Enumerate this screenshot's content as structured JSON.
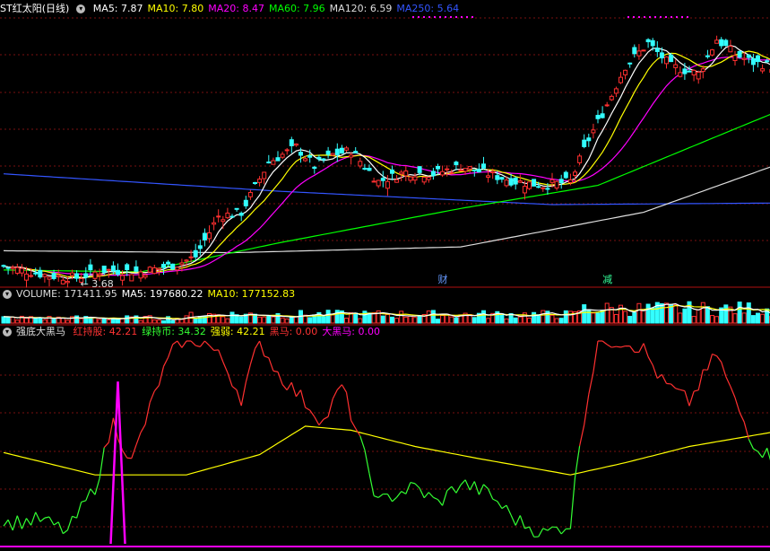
{
  "price_panel": {
    "stock_name": "ST红太阳(日线)",
    "indicators": [
      {
        "label": "MA5: 7.87",
        "color": "#ffffff"
      },
      {
        "label": "MA10: 7.80",
        "color": "#ffff00"
      },
      {
        "label": "MA20: 8.47",
        "color": "#ff00ff"
      },
      {
        "label": "MA60: 7.96",
        "color": "#00ff00"
      },
      {
        "label": "MA120: 6.59",
        "color": "#dddddd"
      },
      {
        "label": "MA250: 5.64",
        "color": "#3355ff"
      }
    ],
    "min_price_label": "3.68",
    "event_markers": [
      "财",
      "减"
    ]
  },
  "volume_panel": {
    "indicators": [
      {
        "label": "VOLUME: 171411.95",
        "color": "#dddddd"
      },
      {
        "label": "MA5: 197680.22",
        "color": "#ffffff"
      },
      {
        "label": "MA10: 177152.83",
        "color": "#ffff00"
      }
    ]
  },
  "indicator_panel": {
    "name": "强底大黑马",
    "indicators": [
      {
        "label": "红持股: 42.21",
        "color": "#ff3333"
      },
      {
        "label": "绿持币: 34.32",
        "color": "#33ff33"
      },
      {
        "label": "强弱: 42.21",
        "color": "#ffff00"
      },
      {
        "label": "黑马: 0.00",
        "color": "#ff3333"
      },
      {
        "label": "大黑马: 0.00",
        "color": "#ff00ff"
      }
    ]
  },
  "chart_data": {
    "type": "candlestick",
    "price": {
      "anchors": [
        [
          0,
          4.0
        ],
        [
          10,
          3.75
        ],
        [
          16,
          3.7
        ],
        [
          22,
          3.9
        ],
        [
          30,
          3.85
        ],
        [
          38,
          4.05
        ],
        [
          42,
          4.25
        ],
        [
          47,
          5.3
        ],
        [
          52,
          5.4
        ],
        [
          58,
          6.7
        ],
        [
          64,
          7.1
        ],
        [
          68,
          6.6
        ],
        [
          72,
          6.9
        ],
        [
          76,
          7.0
        ],
        [
          82,
          6.2
        ],
        [
          88,
          6.45
        ],
        [
          94,
          6.4
        ],
        [
          100,
          6.6
        ],
        [
          106,
          6.4
        ],
        [
          112,
          6.2
        ],
        [
          118,
          6.1
        ],
        [
          124,
          6.2
        ],
        [
          128,
          7.3
        ],
        [
          132,
          8.2
        ],
        [
          136,
          9.2
        ],
        [
          141,
          9.8
        ],
        [
          146,
          9.2
        ],
        [
          152,
          9.0
        ],
        [
          156,
          9.9
        ],
        [
          160,
          9.5
        ],
        [
          164,
          9.3
        ],
        [
          168,
          9.2
        ]
      ],
      "ma60_anchors": [
        [
          0,
          3.9
        ],
        [
          30,
          3.85
        ],
        [
          60,
          4.6
        ],
        [
          100,
          5.5
        ],
        [
          130,
          6.1
        ],
        [
          168,
          7.96
        ]
      ],
      "ma120_anchors": [
        [
          0,
          4.4
        ],
        [
          50,
          4.35
        ],
        [
          100,
          4.5
        ],
        [
          140,
          5.4
        ],
        [
          168,
          6.59
        ]
      ],
      "ma250_anchors": [
        [
          0,
          6.4
        ],
        [
          60,
          5.95
        ],
        [
          120,
          5.6
        ],
        [
          168,
          5.64
        ]
      ],
      "ylim": [
        3.5,
        10.5
      ]
    },
    "oscillator": {
      "red_green_anchors": [
        [
          0,
          10
        ],
        [
          8,
          12
        ],
        [
          14,
          6
        ],
        [
          20,
          28
        ],
        [
          24,
          60
        ],
        [
          28,
          40
        ],
        [
          34,
          80
        ],
        [
          38,
          100
        ],
        [
          44,
          100
        ],
        [
          48,
          90
        ],
        [
          52,
          72
        ],
        [
          56,
          100
        ],
        [
          60,
          84
        ],
        [
          66,
          70
        ],
        [
          70,
          60
        ],
        [
          74,
          78
        ],
        [
          78,
          50
        ],
        [
          82,
          20
        ],
        [
          86,
          25
        ],
        [
          90,
          28
        ],
        [
          95,
          20
        ],
        [
          100,
          30
        ],
        [
          106,
          25
        ],
        [
          112,
          12
        ],
        [
          118,
          5
        ],
        [
          124,
          10
        ],
        [
          126,
          50
        ],
        [
          130,
          100
        ],
        [
          136,
          100
        ],
        [
          140,
          96
        ],
        [
          144,
          80
        ],
        [
          150,
          70
        ],
        [
          156,
          94
        ],
        [
          160,
          70
        ],
        [
          164,
          50
        ],
        [
          168,
          42.21
        ]
      ],
      "strength_anchors": [
        [
          0,
          45
        ],
        [
          20,
          34
        ],
        [
          40,
          34
        ],
        [
          56,
          44
        ],
        [
          66,
          58
        ],
        [
          76,
          56
        ],
        [
          90,
          48
        ],
        [
          104,
          42
        ],
        [
          124,
          34
        ],
        [
          136,
          40
        ],
        [
          150,
          48
        ],
        [
          168,
          55
        ]
      ],
      "spike": {
        "index": 25,
        "value": 80
      },
      "ylim": [
        0,
        100
      ]
    }
  }
}
